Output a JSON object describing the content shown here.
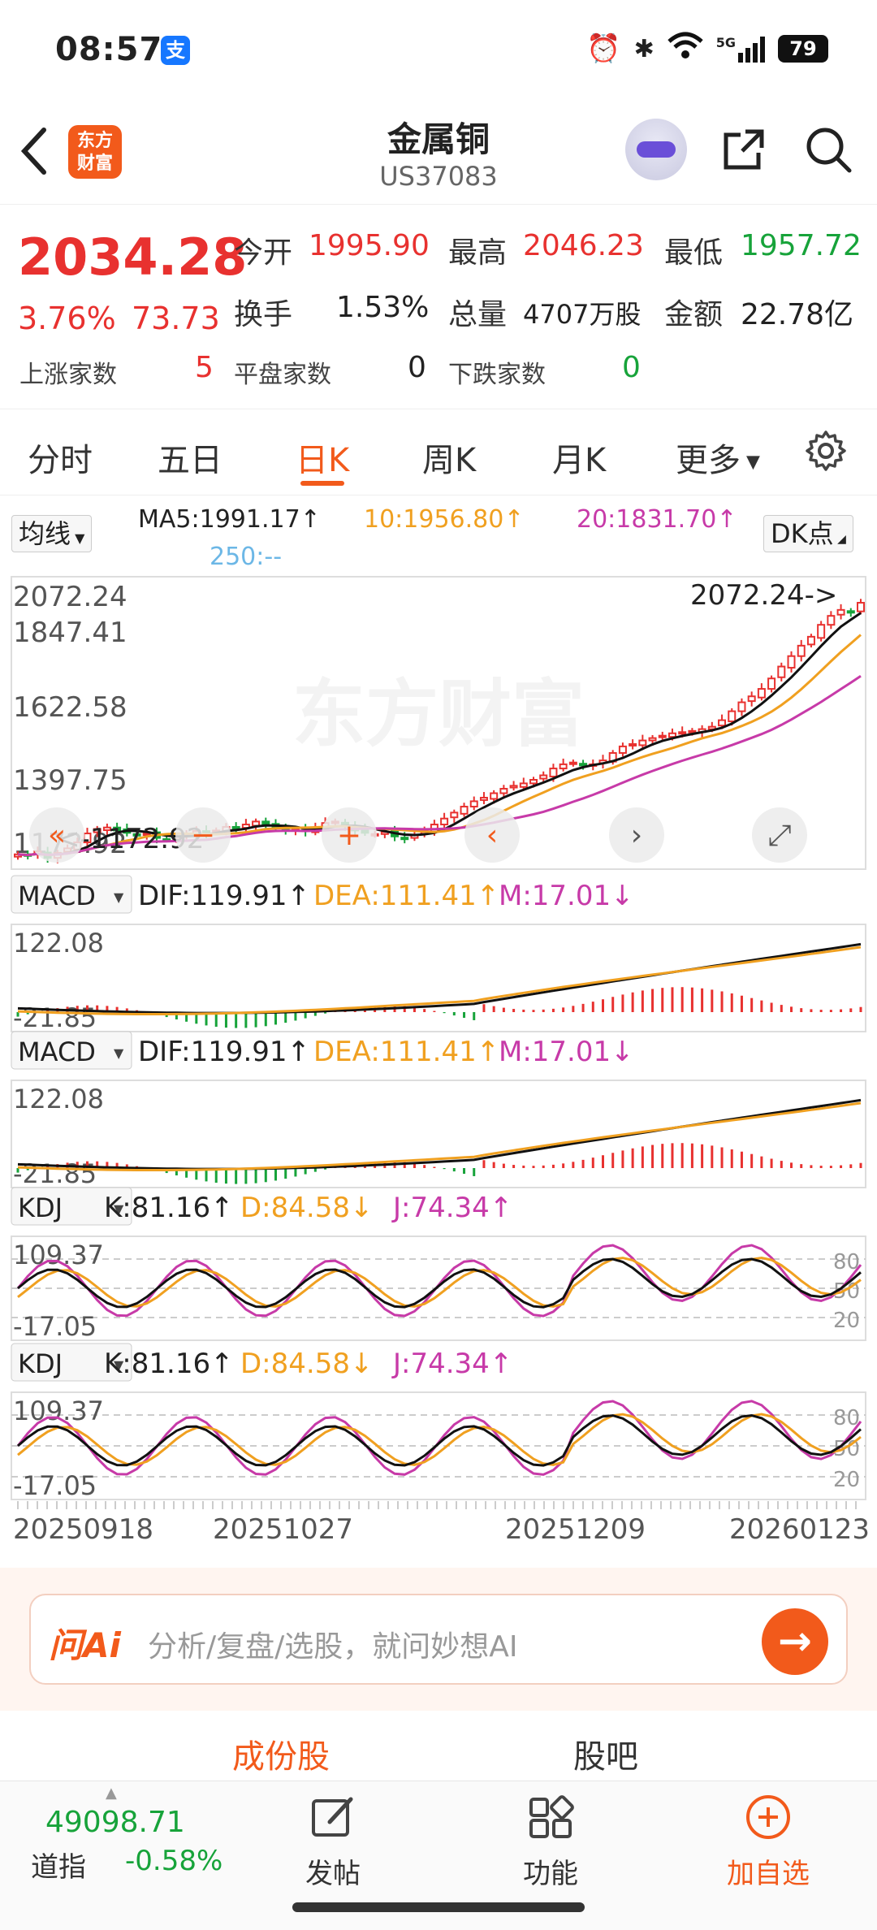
{
  "status": {
    "time": "08:57",
    "battery": "79",
    "network": "5G"
  },
  "header": {
    "logo_line1": "东方",
    "logo_line2": "财富",
    "title": "金属铜",
    "code": "US37083"
  },
  "quote": {
    "price": "2034.28",
    "change_pct": "3.76%",
    "change": "73.73",
    "open_label": "今开",
    "open": "1995.90",
    "high_label": "最高",
    "high": "2046.23",
    "low_label": "最低",
    "low": "1957.72",
    "turnover_label": "换手",
    "turnover": "1.53%",
    "volume_label": "总量",
    "volume": "4707万股",
    "amount_label": "金额",
    "amount": "22.78亿",
    "up_label": "上涨家数",
    "up": "5",
    "flat_label": "平盘家数",
    "flat": "0",
    "down_label": "下跌家数",
    "down": "0"
  },
  "tabs": {
    "items": [
      "分时",
      "五日",
      "日K",
      "周K",
      "月K",
      "更多"
    ],
    "active": "日K"
  },
  "chart_controls": {
    "ma_select": "均线",
    "ma5": "MA5:1991.17↑",
    "ma10": "10:1956.80↑",
    "ma20": "20:1831.70↑",
    "ma250": "250:--",
    "dk": "DK点"
  },
  "colors": {
    "red": "#e8312f",
    "green": "#17a33a",
    "orange": "#f0a020",
    "magenta": "#c73aa8",
    "accent": "#f25a1b",
    "blue": "#6cb7e6"
  },
  "chart_data": [
    {
      "type": "candlestick",
      "name": "日K",
      "y_ticks": [
        "2072.24",
        "1847.41",
        "1622.58",
        "1397.75",
        "1172.92"
      ],
      "ylim": [
        1172.92,
        2072.24
      ],
      "annotations": {
        "high": "2072.24->",
        "low": "<-1172.92"
      },
      "watermark": "东方财富",
      "x_ticks": [
        "20250918",
        "20251027",
        "20251209",
        "20260123"
      ],
      "close": [
        1190,
        1185,
        1200,
        1178,
        1195,
        1210,
        1230,
        1260,
        1275,
        1280,
        1270,
        1262,
        1255,
        1260,
        1245,
        1240,
        1250,
        1258,
        1268,
        1262,
        1270,
        1282,
        1275,
        1290,
        1300,
        1288,
        1278,
        1270,
        1275,
        1268,
        1280,
        1295,
        1300,
        1285,
        1270,
        1262,
        1258,
        1265,
        1250,
        1245,
        1255,
        1270,
        1290,
        1310,
        1330,
        1350,
        1368,
        1380,
        1395,
        1410,
        1420,
        1428,
        1440,
        1455,
        1478,
        1492,
        1498,
        1488,
        1492,
        1505,
        1530,
        1552,
        1560,
        1572,
        1580,
        1588,
        1596,
        1600,
        1604,
        1610,
        1618,
        1640,
        1670,
        1700,
        1720,
        1745,
        1780,
        1820,
        1855,
        1890,
        1920,
        1960,
        1990,
        2010,
        2005,
        2034
      ]
    },
    {
      "type": "bar",
      "name": "MACD",
      "label": "MACD",
      "dif": "DIF:119.91↑",
      "dea": "DEA:111.41↑",
      "m": "M:17.01↓",
      "y_ticks": [
        "122.08",
        "-21.85"
      ],
      "ylim": [
        -21.85,
        122.08
      ]
    },
    {
      "type": "line",
      "name": "KDJ",
      "label": "KDJ",
      "k": "K:81.16↑",
      "d": "D:84.58↓",
      "j": "J:74.34↑",
      "y_ticks": [
        "109.37",
        "-17.05"
      ],
      "ylim": [
        -17.05,
        109.37
      ],
      "ref_lines": [
        "80",
        "50",
        "20"
      ]
    }
  ],
  "ai": {
    "logo": "问Ai",
    "placeholder": "分析/复盘/选股，就问妙想AI"
  },
  "subtabs": {
    "items": [
      "成份股",
      "股吧"
    ],
    "active": "成份股"
  },
  "bottom": {
    "index_value": "49098.71",
    "index_name": "道指",
    "index_change": "-0.58%",
    "items": [
      "发帖",
      "功能",
      "加自选"
    ]
  }
}
